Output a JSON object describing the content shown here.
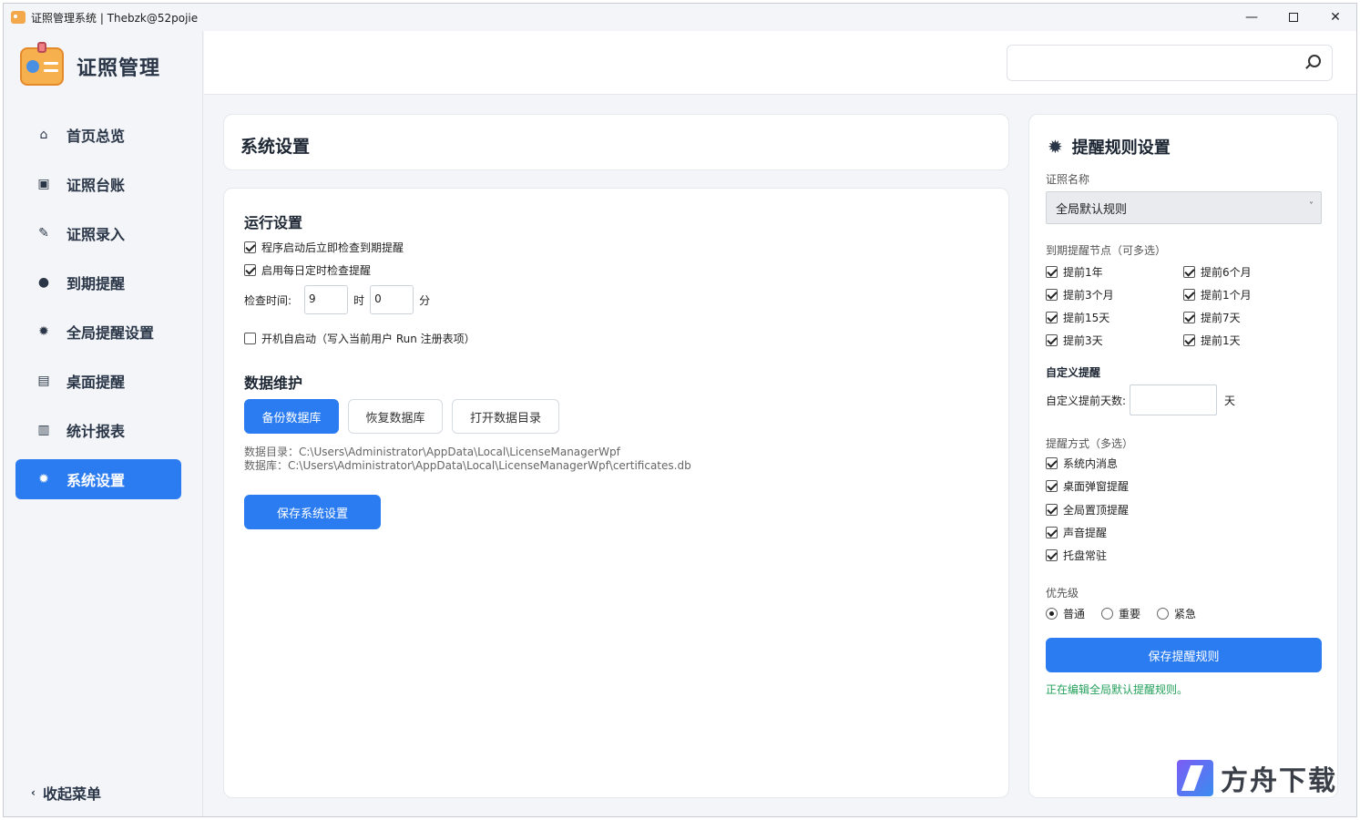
{
  "window": {
    "title": "证照管理系统 | Thebzk@52pojie",
    "minimize_glyph": "—",
    "close_glyph": "✕"
  },
  "brand": {
    "name": "证照管理"
  },
  "nav": {
    "items": [
      {
        "label": "首页总览",
        "icon": "⌂",
        "icon_name": "home-icon"
      },
      {
        "label": "证照台账",
        "icon": "▣",
        "icon_name": "ledger-icon"
      },
      {
        "label": "证照录入",
        "icon": "✎",
        "icon_name": "pen-icon"
      },
      {
        "label": "到期提醒",
        "icon": "●",
        "icon_name": "dot-icon"
      },
      {
        "label": "全局提醒设置",
        "icon": "✹",
        "icon_name": "gear-icon"
      },
      {
        "label": "桌面提醒",
        "icon": "▤",
        "icon_name": "list-icon"
      },
      {
        "label": "统计报表",
        "icon": "▥",
        "icon_name": "chart-icon"
      },
      {
        "label": "系统设置",
        "icon": "✹",
        "icon_name": "gear-icon"
      }
    ],
    "active_index": 7,
    "collapse_icon": "‹",
    "collapse_label": "收起菜单"
  },
  "search": {
    "placeholder": "",
    "value": ""
  },
  "page": {
    "title": "系统设置"
  },
  "run_settings": {
    "heading": "运行设置",
    "check_on_start": {
      "label": "程序启动后立即检查到期提醒",
      "checked": true
    },
    "daily_check": {
      "label": "启用每日定时检查提醒",
      "checked": true
    },
    "check_time_label": "检查时间:",
    "hour_value": "9",
    "hour_unit": "时",
    "minute_value": "0",
    "minute_unit": "分",
    "autostart": {
      "label": "开机自启动（写入当前用户 Run 注册表项）",
      "checked": false
    }
  },
  "data_maintenance": {
    "heading": "数据维护",
    "backup_label": "备份数据库",
    "restore_label": "恢复数据库",
    "open_dir_label": "打开数据目录",
    "data_dir": "数据目录：C:\\Users\\Administrator\\AppData\\Local\\LicenseManagerWpf",
    "database": "数据库：C:\\Users\\Administrator\\AppData\\Local\\LicenseManagerWpf\\certificates.db",
    "save_label": "保存系统设置"
  },
  "rule_panel": {
    "title": "提醒规则设置",
    "cert_name_label": "证照名称",
    "cert_name_value": "全局默认规则",
    "select_caret": "˅",
    "nodes_label": "到期提醒节点（可多选）",
    "nodes": [
      {
        "label": "提前1年",
        "checked": true
      },
      {
        "label": "提前6个月",
        "checked": true
      },
      {
        "label": "提前3个月",
        "checked": true
      },
      {
        "label": "提前1个月",
        "checked": true
      },
      {
        "label": "提前15天",
        "checked": true
      },
      {
        "label": "提前7天",
        "checked": true
      },
      {
        "label": "提前3天",
        "checked": true
      },
      {
        "label": "提前1天",
        "checked": true
      }
    ],
    "custom_heading": "自定义提醒",
    "custom_days_label": "自定义提前天数:",
    "custom_days_value": "",
    "custom_days_unit": "天",
    "methods_label": "提醒方式（多选）",
    "methods": [
      {
        "label": "系统内消息",
        "checked": true
      },
      {
        "label": "桌面弹窗提醒",
        "checked": true
      },
      {
        "label": "全局置顶提醒",
        "checked": true
      },
      {
        "label": "声音提醒",
        "checked": true
      },
      {
        "label": "托盘常驻",
        "checked": true
      }
    ],
    "priority_label": "优先级",
    "priorities": [
      {
        "label": "普通",
        "selected": true
      },
      {
        "label": "重要",
        "selected": false
      },
      {
        "label": "紧急",
        "selected": false
      }
    ],
    "save_label": "保存提醒规则",
    "status": "正在编辑全局默认提醒规则。",
    "status_color": "#23a05a"
  },
  "watermark": {
    "text": "方舟下载"
  },
  "colors": {
    "accent": "#2b7cf0",
    "sidebar_bg": "#f3f5f8",
    "text_dark": "#1d2633"
  }
}
